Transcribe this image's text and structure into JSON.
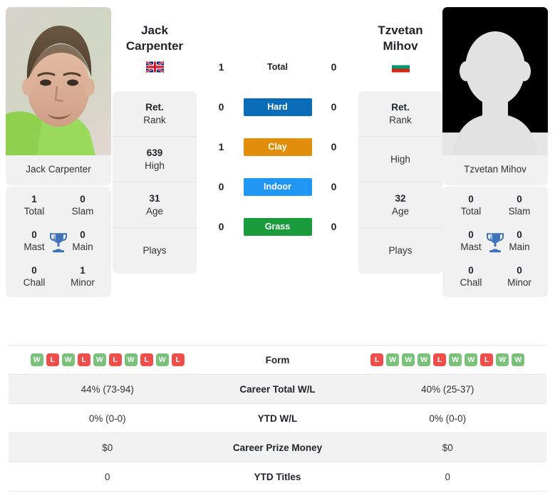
{
  "players": {
    "left": {
      "name_line1": "Jack",
      "name_line2": "Carpenter",
      "full_name": "Jack Carpenter",
      "photo_caption": "Jack Carpenter",
      "flag": "united-kingdom-flag",
      "flag_alt": "United Kingdom",
      "info": [
        {
          "value": "Ret.",
          "label": "Rank"
        },
        {
          "value": "639",
          "label": "High"
        },
        {
          "value": "31",
          "label": "Age"
        },
        {
          "value": "",
          "label": "Plays"
        }
      ],
      "titles": [
        {
          "value": "1",
          "label": "Total"
        },
        {
          "value": "0",
          "label": "Slam"
        },
        {
          "value": "0",
          "label": "Mast"
        },
        {
          "value": "0",
          "label": "Main"
        },
        {
          "value": "0",
          "label": "Chall"
        },
        {
          "value": "1",
          "label": "Minor"
        }
      ],
      "form": [
        "W",
        "L",
        "W",
        "L",
        "W",
        "L",
        "W",
        "L",
        "W",
        "L"
      ],
      "career_total_wl": "44% (73-94)",
      "ytd_wl": "0% (0-0)",
      "career_prize_money": "$0",
      "ytd_titles": "0"
    },
    "right": {
      "name_line1": "Tzvetan",
      "name_line2": "Mihov",
      "full_name": "Tzvetan Mihov",
      "photo_caption": "Tzvetan Mihov",
      "flag": "bulgaria-flag",
      "flag_alt": "Bulgaria",
      "info": [
        {
          "value": "Ret.",
          "label": "Rank"
        },
        {
          "value": "",
          "label": "High"
        },
        {
          "value": "32",
          "label": "Age"
        },
        {
          "value": "",
          "label": "Plays"
        }
      ],
      "titles": [
        {
          "value": "0",
          "label": "Total"
        },
        {
          "value": "0",
          "label": "Slam"
        },
        {
          "value": "0",
          "label": "Mast"
        },
        {
          "value": "0",
          "label": "Main"
        },
        {
          "value": "0",
          "label": "Chall"
        },
        {
          "value": "0",
          "label": "Minor"
        }
      ],
      "form": [
        "L",
        "W",
        "W",
        "W",
        "L",
        "W",
        "W",
        "L",
        "W",
        "W"
      ],
      "career_total_wl": "40% (25-37)",
      "ytd_wl": "0% (0-0)",
      "career_prize_money": "$0",
      "ytd_titles": "0"
    }
  },
  "head_to_head": [
    {
      "left": "1",
      "surface": "Total",
      "right": "0",
      "badge": false,
      "color": ""
    },
    {
      "left": "0",
      "surface": "Hard",
      "right": "0",
      "badge": true,
      "color": "#0b6cb8"
    },
    {
      "left": "1",
      "surface": "Clay",
      "right": "0",
      "badge": true,
      "color": "#e08e0b"
    },
    {
      "left": "0",
      "surface": "Indoor",
      "right": "0",
      "badge": true,
      "color": "#2196f3"
    },
    {
      "left": "0",
      "surface": "Grass",
      "right": "0",
      "badge": true,
      "color": "#1a9c3c"
    }
  ],
  "table": {
    "rows": [
      {
        "label": "Form",
        "type": "form"
      },
      {
        "label": "Career Total W/L",
        "type": "text",
        "left": "44% (73-94)",
        "right": "40% (25-37)"
      },
      {
        "label": "YTD W/L",
        "type": "text",
        "left": "0% (0-0)",
        "right": "0% (0-0)"
      },
      {
        "label": "Career Prize Money",
        "type": "text",
        "left": "$0",
        "right": "$0"
      },
      {
        "label": "YTD Titles",
        "type": "text",
        "left": "0",
        "right": "0"
      }
    ]
  },
  "colors": {
    "win": "#7ac17a",
    "loss": "#ef4f4a",
    "hard": "#0b6cb8",
    "clay": "#e08e0b",
    "indoor": "#2196f3",
    "grass": "#1a9c3c",
    "card_bg": "#f1f1f1",
    "trophy": "#3f72b8"
  },
  "icons": {
    "trophy": "trophy-icon"
  }
}
